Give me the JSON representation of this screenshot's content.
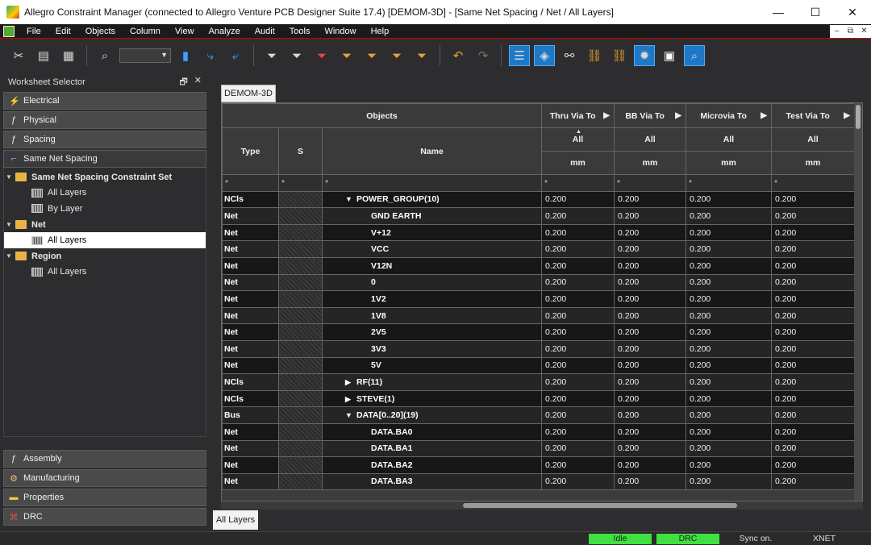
{
  "window": {
    "title": "Allegro Constraint Manager (connected to Allegro Venture PCB Designer Suite 17.4) [DEMOM-3D] - [Same Net Spacing / Net / All Layers]",
    "minimize": "—",
    "maximize": "☐",
    "close": "✕"
  },
  "menu": {
    "items": [
      "File",
      "Edit",
      "Objects",
      "Column",
      "View",
      "Analyze",
      "Audit",
      "Tools",
      "Window",
      "Help"
    ],
    "mdi": [
      "–",
      "⧉",
      "✕"
    ]
  },
  "toolbar": {
    "icons": [
      "scissors-icon",
      "copy-icon",
      "paste-icon",
      "find-icon",
      "combo",
      "bookmark-icon",
      "bookmark-next-icon",
      "bookmark-prev-icon",
      "filter-icon",
      "filter2-icon",
      "filter-error-icon",
      "filter3-icon",
      "filter4-icon",
      "filter5-icon",
      "filter6-icon",
      "undo-icon",
      "redo-icon",
      "sheet-icon",
      "tag-icon",
      "net-icon",
      "link-icon",
      "link2-icon",
      "settings-icon",
      "report-icon",
      "search-icon"
    ]
  },
  "worksheet_selector": {
    "title": "Worksheet Selector",
    "pin": "🗗",
    "close": "✕",
    "categories_top": [
      {
        "label": "Electrical",
        "icon": "⚡"
      },
      {
        "label": "Physical",
        "icon": "ƒ"
      },
      {
        "label": "Spacing",
        "icon": "ƒ"
      },
      {
        "label": "Same Net Spacing",
        "icon": "⌐"
      }
    ],
    "tree": [
      {
        "label": "Same Net Spacing Constraint Set",
        "level": 0,
        "type": "folder",
        "bold": true,
        "expanded": true
      },
      {
        "label": "All Layers",
        "level": 1,
        "type": "sheet"
      },
      {
        "label": "By Layer",
        "level": 1,
        "type": "sheet"
      },
      {
        "label": "Net",
        "level": 0,
        "type": "folder",
        "bold": true,
        "expanded": true
      },
      {
        "label": "All Layers",
        "level": 1,
        "type": "sheet",
        "selected": true
      },
      {
        "label": "Region",
        "level": 0,
        "type": "folder",
        "bold": true,
        "expanded": true
      },
      {
        "label": "All Layers",
        "level": 1,
        "type": "sheet"
      }
    ],
    "categories_bottom": [
      {
        "label": "Assembly",
        "icon": "ƒ"
      },
      {
        "label": "Manufacturing",
        "icon": "⚙"
      },
      {
        "label": "Properties",
        "icon": "▬"
      },
      {
        "label": "DRC",
        "icon": "⌘"
      }
    ]
  },
  "document_tab": "DEMOM-3D",
  "grid": {
    "objects_header": "Objects",
    "type_header": "Type",
    "s_header": "S",
    "name_header": "Name",
    "columns": [
      {
        "label": "Thru Via To",
        "sub": "All",
        "unit": "mm",
        "sorted": true
      },
      {
        "label": "BB Via To",
        "sub": "All",
        "unit": "mm"
      },
      {
        "label": "Microvia To",
        "sub": "All",
        "unit": "mm"
      },
      {
        "label": "Test Via To",
        "sub": "All",
        "unit": "mm"
      }
    ],
    "filter": "*",
    "rows": [
      {
        "type": "NCls",
        "name": "POWER_GROUP(10)",
        "indent": 1,
        "expander": "▼",
        "values": [
          "0.200",
          "0.200",
          "0.200",
          "0.200"
        ]
      },
      {
        "type": "Net",
        "name": "GND EARTH",
        "indent": 2,
        "values": [
          "0.200",
          "0.200",
          "0.200",
          "0.200"
        ]
      },
      {
        "type": "Net",
        "name": "V+12",
        "indent": 2,
        "values": [
          "0.200",
          "0.200",
          "0.200",
          "0.200"
        ]
      },
      {
        "type": "Net",
        "name": "VCC",
        "indent": 2,
        "values": [
          "0.200",
          "0.200",
          "0.200",
          "0.200"
        ]
      },
      {
        "type": "Net",
        "name": "V12N",
        "indent": 2,
        "values": [
          "0.200",
          "0.200",
          "0.200",
          "0.200"
        ]
      },
      {
        "type": "Net",
        "name": "0",
        "indent": 2,
        "values": [
          "0.200",
          "0.200",
          "0.200",
          "0.200"
        ]
      },
      {
        "type": "Net",
        "name": "1V2",
        "indent": 2,
        "values": [
          "0.200",
          "0.200",
          "0.200",
          "0.200"
        ]
      },
      {
        "type": "Net",
        "name": "1V8",
        "indent": 2,
        "values": [
          "0.200",
          "0.200",
          "0.200",
          "0.200"
        ]
      },
      {
        "type": "Net",
        "name": "2V5",
        "indent": 2,
        "values": [
          "0.200",
          "0.200",
          "0.200",
          "0.200"
        ]
      },
      {
        "type": "Net",
        "name": "3V3",
        "indent": 2,
        "values": [
          "0.200",
          "0.200",
          "0.200",
          "0.200"
        ]
      },
      {
        "type": "Net",
        "name": "5V",
        "indent": 2,
        "values": [
          "0.200",
          "0.200",
          "0.200",
          "0.200"
        ]
      },
      {
        "type": "NCls",
        "name": "RF(11)",
        "indent": 1,
        "expander": "▶",
        "values": [
          "0.200",
          "0.200",
          "0.200",
          "0.200"
        ]
      },
      {
        "type": "NCls",
        "name": "STEVE(1)",
        "indent": 1,
        "expander": "▶",
        "values": [
          "0.200",
          "0.200",
          "0.200",
          "0.200"
        ]
      },
      {
        "type": "Bus",
        "name": "DATA[0..20](19)",
        "indent": 1,
        "expander": "▼",
        "values": [
          "0.200",
          "0.200",
          "0.200",
          "0.200"
        ]
      },
      {
        "type": "Net",
        "name": "DATA.BA0",
        "indent": 2,
        "values": [
          "0.200",
          "0.200",
          "0.200",
          "0.200"
        ]
      },
      {
        "type": "Net",
        "name": "DATA.BA1",
        "indent": 2,
        "values": [
          "0.200",
          "0.200",
          "0.200",
          "0.200"
        ]
      },
      {
        "type": "Net",
        "name": "DATA.BA2",
        "indent": 2,
        "values": [
          "0.200",
          "0.200",
          "0.200",
          "0.200"
        ]
      },
      {
        "type": "Net",
        "name": "DATA.BA3",
        "indent": 2,
        "values": [
          "0.200",
          "0.200",
          "0.200",
          "0.200"
        ]
      }
    ]
  },
  "bottom_tab": "All Layers",
  "status": {
    "idle": "Idle",
    "drc": "DRC",
    "sync": "Sync on.",
    "mode": "XNET"
  },
  "colors": {
    "accent_blue": "#1e78c8",
    "status_green": "#3fe03f",
    "folder": "#e8b545"
  }
}
